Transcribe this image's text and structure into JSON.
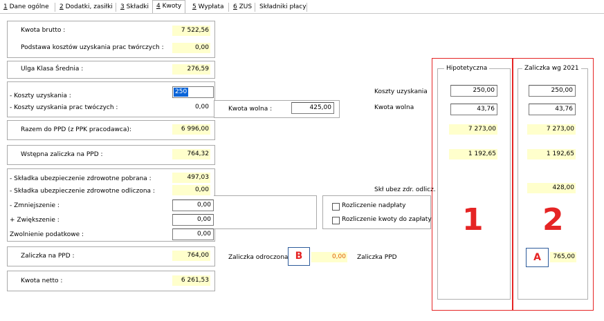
{
  "tabs": [
    {
      "key": "1",
      "rest": " Dane ogólne"
    },
    {
      "key": "2",
      "rest": " Dodatki, zasiłki"
    },
    {
      "key": "3",
      "rest": " Składki"
    },
    {
      "key": "4",
      "rest": " Kwoty"
    },
    {
      "key": "5",
      "rest": " Wypłata"
    },
    {
      "key": "6",
      "rest": " ZUS"
    },
    {
      "key": "",
      "rest": "Składniki płacy"
    }
  ],
  "active_tab": "4 Kwoty",
  "left": {
    "kwota_brutto_label": "Kwota brutto :",
    "kwota_brutto": "7 522,56",
    "podstawa_label": "Podstawa kosztów uzyskania prac twórczych :",
    "podstawa": "0,00",
    "ulga_label": "Ulga Klasa Średnia :",
    "ulga": "276,59",
    "koszty_label": "- Koszty uzyskania :",
    "koszty_input": "250",
    "koszty_tw_label": "- Koszty uzyskania prac twóczych :",
    "koszty_tw": "0,00",
    "kwota_wolna_label": "Kwota wolna :",
    "kwota_wolna": "425,00",
    "razem_label": "Razem do PPD (z PPK pracodawca):",
    "razem": "6 996,00",
    "wstepna_label": "Wstępna zaliczka na PPD :",
    "wstepna": "764,32",
    "skl_pobrana_label": "- Składka ubezpieczenie zdrowotne pobrana :",
    "skl_pobrana": "497,03",
    "skl_odliczona_label": "- Składka ubezpieczenie zdrowotne odliczona :",
    "skl_odliczona": "0,00",
    "zmniejszenie_label": "- Zmniejszenie :",
    "zmniejszenie": "0,00",
    "zwiekszenie_label": "+ Zwiększenie :",
    "zwiekszenie": "0,00",
    "zwolnienie_label": "Zwolnienie podatkowe :",
    "zwolnienie": "0,00",
    "rozl_nadplaty_label": "Rozliczenie nadpłaty",
    "rozl_kwoty_label": "Rozliczenie kwoty do zapłaty",
    "zaliczka_label": "Zaliczka na PPD :",
    "zaliczka": "764,00",
    "odroczona_label": "Zaliczka odroczona",
    "odroczona": "0,00",
    "kwota_netto_label": "Kwota netto :",
    "kwota_netto": "6 261,53"
  },
  "right_labels": {
    "koszty": "Koszty uzyskania",
    "kwota_wolna": "Kwota wolna",
    "skl_ubez": "Skł ubez zdr. odlicz.",
    "zaliczka_ppd": "Zaliczka PPD"
  },
  "hipotetyczna": {
    "title": "Hipotetyczna",
    "koszty": "250,00",
    "kwota_wolna": "43,76",
    "v1": "7 273,00",
    "v2": "1 192,65"
  },
  "wg2021": {
    "title": "Zaliczka wg 2021",
    "koszty": "250,00",
    "kwota_wolna": "43,76",
    "v1": "7 273,00",
    "v2": "1 192,65",
    "skl": "428,00",
    "zaliczka": "765,00"
  },
  "annotations": {
    "num1": "1",
    "num2": "2",
    "boxA": "A",
    "boxB": "B",
    "red": "#e52424",
    "blue": "#2c5a9a"
  },
  "colors": {
    "value_bg": "#ffffcc",
    "selection": "#0a64d8"
  }
}
